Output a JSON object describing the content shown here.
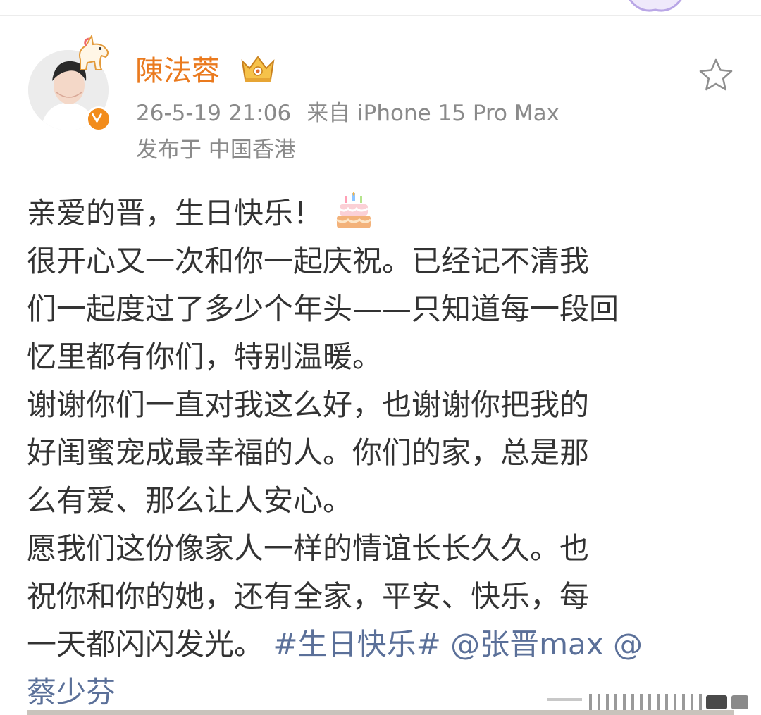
{
  "post": {
    "username": "陳法蓉",
    "timestamp": "26-5-19 21:06",
    "source": "来自 iPhone 15 Pro Max",
    "location": "发布于 中国香港",
    "lines": [
      "亲爱的晋，生日快乐！",
      "很开心又一次和你一起庆祝。已经记不清我",
      "们一起度过了多少个年头——只知道每一段回",
      "忆里都有你们，特别温暖。",
      "谢谢你们一直对我这么好，也谢谢你把我的",
      "好闺蜜宠成最幸福的人。你们的家，总是那",
      "么有爱、那么让人安心。",
      "愿我们这份像家人一样的情谊长长久久。也",
      "祝你和你的她，还有全家，平安、快乐，每",
      "一天都闪闪发光。"
    ],
    "topic": "#生日快乐#",
    "mention_1": "@张晋max",
    "mention_2": "@蔡少芬"
  },
  "icons": {
    "avatar_pendant": "unicorn-pendant-icon",
    "verified": "verified-badge-icon",
    "vip": "crown-vip-badge-icon",
    "favorite": "star-outline-icon",
    "emoji": "birthday-cake-emoji"
  },
  "colors": {
    "username": "#ea7a1e",
    "meta": "#8a8a8a",
    "body": "#333333",
    "link": "#5b7099",
    "verified": "#f28c1c"
  }
}
